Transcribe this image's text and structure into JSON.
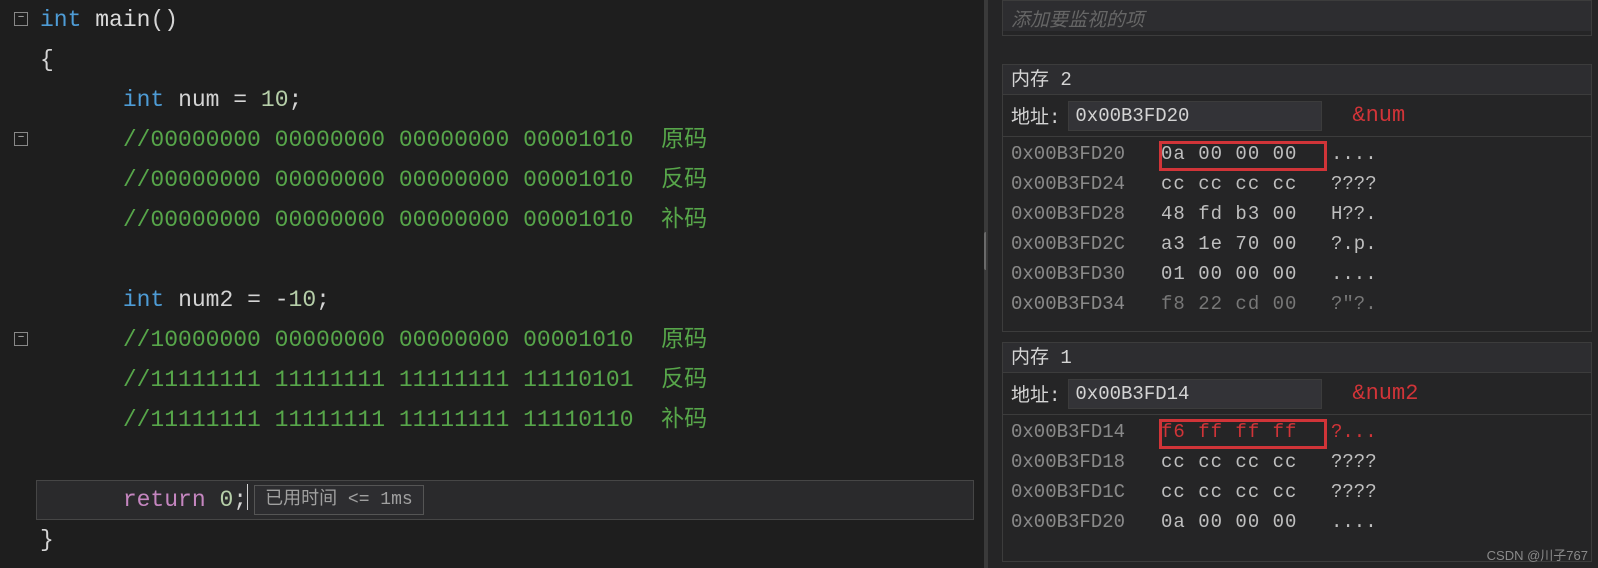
{
  "editor": {
    "lines": [
      {
        "indent": 0,
        "kind": "decl",
        "parts": [
          "int",
          " ",
          "main",
          "()"
        ]
      },
      {
        "indent": 0,
        "kind": "brace",
        "text": "{"
      },
      {
        "indent": 1,
        "kind": "vardecl",
        "type": "int",
        "name": "num",
        "eq": " = ",
        "value": "10",
        "semi": ";"
      },
      {
        "indent": 1,
        "kind": "comment",
        "text": "//00000000 00000000 00000000 00001010  原码"
      },
      {
        "indent": 1,
        "kind": "comment",
        "text": "//00000000 00000000 00000000 00001010  反码"
      },
      {
        "indent": 1,
        "kind": "comment",
        "text": "//00000000 00000000 00000000 00001010  补码"
      },
      {
        "indent": 1,
        "kind": "blank"
      },
      {
        "indent": 1,
        "kind": "vardecl",
        "type": "int",
        "name": "num2",
        "eq": " = ",
        "value": "-10",
        "semi": ";"
      },
      {
        "indent": 1,
        "kind": "comment",
        "text": "//10000000 00000000 00000000 00001010  原码"
      },
      {
        "indent": 1,
        "kind": "comment",
        "text": "//11111111 11111111 11111111 11110101  反码"
      },
      {
        "indent": 1,
        "kind": "comment",
        "text": "//11111111 11111111 11111111 11110110  补码"
      },
      {
        "indent": 1,
        "kind": "blank"
      },
      {
        "indent": 1,
        "kind": "return",
        "kw": "return",
        "sp": " ",
        "value": "0",
        "semi": ";"
      },
      {
        "indent": 0,
        "kind": "brace",
        "text": "}"
      }
    ],
    "perf_hint": "已用时间 <= 1ms"
  },
  "right": {
    "watch_cut_title": "添加要监视的项",
    "mem2": {
      "title": "内存 2",
      "addr_label": "地址:",
      "addr_value": "0x00B3FD20",
      "annotation": "&num",
      "rows": [
        {
          "addr": "0x00B3FD20",
          "bytes": "0a 00 00 00",
          "ascii": "....",
          "hl": true
        },
        {
          "addr": "0x00B3FD24",
          "bytes": "cc cc cc cc",
          "ascii": "????"
        },
        {
          "addr": "0x00B3FD28",
          "bytes": "48 fd b3 00",
          "ascii": "H??."
        },
        {
          "addr": "0x00B3FD2C",
          "bytes": "a3 1e 70 00",
          "ascii": "?.p."
        },
        {
          "addr": "0x00B3FD30",
          "bytes": "01 00 00 00",
          "ascii": "...."
        },
        {
          "addr": "0x00B3FD34",
          "bytes": "f8 22 cd 00",
          "ascii": "?\"?.",
          "dim": true
        }
      ]
    },
    "mem1": {
      "title": "内存 1",
      "addr_label": "地址:",
      "addr_value": "0x00B3FD14",
      "annotation": "&num2",
      "rows": [
        {
          "addr": "0x00B3FD14",
          "bytes": "f6 ff ff ff",
          "ascii": "?...",
          "hl": true,
          "red": true
        },
        {
          "addr": "0x00B3FD18",
          "bytes": "cc cc cc cc",
          "ascii": "????"
        },
        {
          "addr": "0x00B3FD1C",
          "bytes": "cc cc cc cc",
          "ascii": "????"
        },
        {
          "addr": "0x00B3FD20",
          "bytes": "0a 00 00 00",
          "ascii": "...."
        }
      ]
    }
  },
  "watermark": "CSDN @川子767"
}
